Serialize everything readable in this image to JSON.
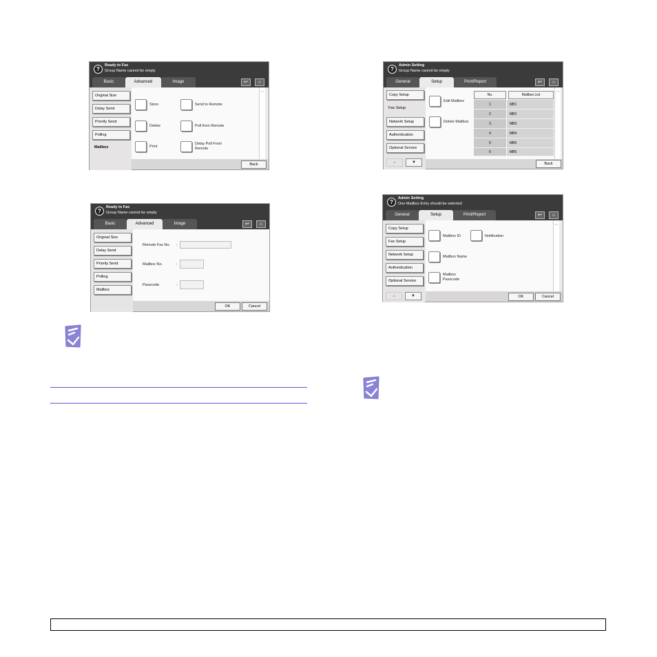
{
  "panel1": {
    "status_title": "Ready to Fax",
    "status_msg": "Group Name cannot be empty",
    "tabs": [
      "Basic",
      "Advanced",
      "Image"
    ],
    "side": [
      "Original Size",
      "Delay Send",
      "Priority Send",
      "Polling",
      "Mailbox"
    ],
    "options": [
      "Store",
      "Send to Remote",
      "Delete",
      "Poll from Remote",
      "Print",
      "Delay Poll From Remote"
    ],
    "back": "Back"
  },
  "panel2": {
    "status_title": "Ready to Fax",
    "status_msg": "Group Name cannot be empty",
    "tabs": [
      "Basic",
      "Advanced",
      "Image"
    ],
    "side": [
      "Original Size",
      "Delay Send",
      "Priority Send",
      "Polling",
      "Mailbox"
    ],
    "fields": [
      "Remote Fax No.",
      "Mailbox No.",
      "Passcode"
    ],
    "colon": ":",
    "ok": "OK",
    "cancel": "Cancel"
  },
  "panel3": {
    "status_title": "Admin Setting",
    "status_msg": "Group Name cannot be empty",
    "tabs": [
      "General",
      "Setup",
      "Print/Report"
    ],
    "side": [
      "Copy Setup",
      "Fax Setup",
      "Network Setup",
      "Authentication",
      "Optional Service"
    ],
    "options": [
      "Edit Mailbox",
      "Delete Mailbox"
    ],
    "table_headers": [
      "No.",
      "Mailbox List"
    ],
    "rows": [
      {
        "no": "1",
        "name": "MB1"
      },
      {
        "no": "2",
        "name": "MB2"
      },
      {
        "no": "3",
        "name": "MB3"
      },
      {
        "no": "4",
        "name": "MB4"
      },
      {
        "no": "5",
        "name": "MB5"
      },
      {
        "no": "6",
        "name": "MB6"
      }
    ],
    "back": "Back"
  },
  "panel4": {
    "status_title": "Admin Setting",
    "status_msg": "One Mailbox Entry should be selected",
    "tabs": [
      "General",
      "Setup",
      "Print/Report"
    ],
    "side": [
      "Copy Setup",
      "Fax Setup",
      "Network Setup",
      "Authentication",
      "Optional Service"
    ],
    "options": [
      "Mailbox ID",
      "Notification",
      "Mailbox Name",
      "Mailbox Passcode"
    ],
    "ok": "OK",
    "cancel": "Cancel"
  },
  "icons": {
    "help": "?",
    "back_arrow": "↩",
    "home": "⌂",
    "up": "▲",
    "down": "▼"
  }
}
